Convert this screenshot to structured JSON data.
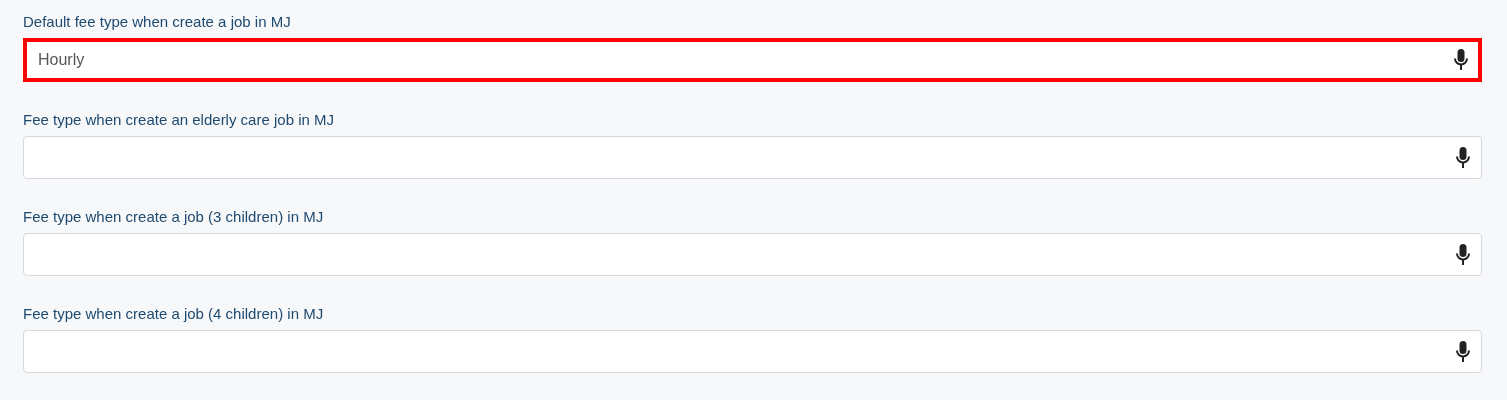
{
  "fields": [
    {
      "label": "Default fee type when create a job in MJ",
      "value": "Hourly",
      "highlighted": true
    },
    {
      "label": "Fee type when create an elderly care job in MJ",
      "highlighted": false
    },
    {
      "label": "Fee type when create a job (3 children) in MJ",
      "highlighted": false
    },
    {
      "label": "Fee type when create a job (4 children) in MJ",
      "highlighted": false
    }
  ]
}
